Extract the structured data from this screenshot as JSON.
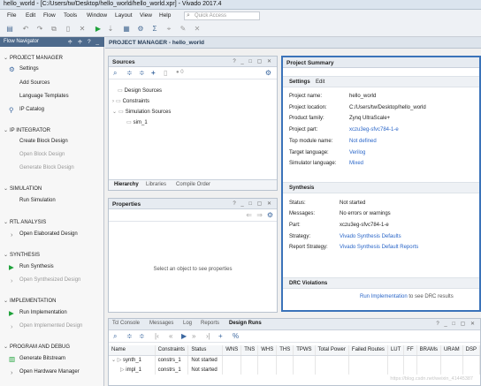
{
  "window": {
    "title": "hello_world - [C:/Users/tw/Desktop/hello_world/hello_world.xpr] - Vivado 2017.4"
  },
  "menu": [
    "File",
    "Edit",
    "Flow",
    "Tools",
    "Window",
    "Layout",
    "View",
    "Help"
  ],
  "quick_access": {
    "placeholder": "Quick Access"
  },
  "flow_navigator": {
    "title": "Flow Navigator",
    "sections": [
      {
        "label": "PROJECT MANAGER",
        "items": [
          {
            "label": "Settings",
            "enabled": true,
            "icon": "gear-icon"
          },
          {
            "label": "Add Sources",
            "enabled": true
          },
          {
            "label": "Language Templates",
            "enabled": true
          },
          {
            "label": "IP Catalog",
            "enabled": true,
            "icon": "ip-icon"
          }
        ]
      },
      {
        "label": "IP INTEGRATOR",
        "items": [
          {
            "label": "Create Block Design",
            "enabled": true
          },
          {
            "label": "Open Block Design",
            "enabled": false
          },
          {
            "label": "Generate Block Design",
            "enabled": false
          }
        ]
      },
      {
        "label": "SIMULATION",
        "items": [
          {
            "label": "Run Simulation",
            "enabled": true
          }
        ]
      },
      {
        "label": "RTL ANALYSIS",
        "items": [
          {
            "label": "Open Elaborated Design",
            "enabled": true,
            "expandable": true
          }
        ]
      },
      {
        "label": "SYNTHESIS",
        "items": [
          {
            "label": "Run Synthesis",
            "enabled": true,
            "icon": "play-icon"
          },
          {
            "label": "Open Synthesized Design",
            "enabled": false,
            "expandable": true
          }
        ]
      },
      {
        "label": "IMPLEMENTATION",
        "items": [
          {
            "label": "Run Implementation",
            "enabled": true,
            "icon": "play-icon"
          },
          {
            "label": "Open Implemented Design",
            "enabled": false,
            "expandable": true
          }
        ]
      },
      {
        "label": "PROGRAM AND DEBUG",
        "items": [
          {
            "label": "Generate Bitstream",
            "enabled": true,
            "icon": "bitstream-icon"
          },
          {
            "label": "Open Hardware Manager",
            "enabled": true,
            "expandable": true
          }
        ]
      }
    ]
  },
  "project_manager_header": "PROJECT MANAGER - hello_world",
  "sources": {
    "title": "Sources",
    "badge": "0",
    "tree": [
      "Design Sources",
      "Constraints",
      "Simulation Sources",
      "sim_1"
    ],
    "tabs": [
      "Hierarchy",
      "Libraries",
      "Compile Order"
    ]
  },
  "properties": {
    "title": "Properties",
    "empty_text": "Select an object to see properties"
  },
  "summary": {
    "title": "Project Summary",
    "settings_label": "Settings",
    "edit_label": "Edit",
    "rows": [
      {
        "label": "Project name:",
        "value": "hello_world",
        "link": false
      },
      {
        "label": "Project location:",
        "value": "C:/Users/tw/Desktop/hello_world",
        "link": false
      },
      {
        "label": "Product family:",
        "value": "Zynq UltraScale+",
        "link": false
      },
      {
        "label": "Project part:",
        "value": "xczu3eg-sfvc784-1-e",
        "link": true
      },
      {
        "label": "Top module name:",
        "value": "Not defined",
        "link": true
      },
      {
        "label": "Target language:",
        "value": "Verilog",
        "link": true
      },
      {
        "label": "Simulator language:",
        "value": "Mixed",
        "link": true
      }
    ],
    "synthesis_label": "Synthesis",
    "synthesis_rows": [
      {
        "label": "Status:",
        "value": "Not started",
        "link": false
      },
      {
        "label": "Messages:",
        "value": "No errors or warnings",
        "link": false
      },
      {
        "label": "Part:",
        "value": "xczu3eg-sfvc784-1-e",
        "link": false
      },
      {
        "label": "Strategy:",
        "value": "Vivado Synthesis Defaults",
        "link": true
      },
      {
        "label": "Report Strategy:",
        "value": "Vivado Synthesis Default Reports",
        "link": true
      }
    ],
    "drc_label": "DRC Violations",
    "drc_link": "Run Implementation",
    "drc_text": "to see DRC results"
  },
  "bottom": {
    "tabs": [
      "Tcl Console",
      "Messages",
      "Log",
      "Reports",
      "Design Runs"
    ],
    "active_tab": "Design Runs",
    "columns": [
      "Name",
      "Constraints",
      "Status",
      "WNS",
      "TNS",
      "WHS",
      "THS",
      "TPWS",
      "Total Power",
      "Failed Routes",
      "LUT",
      "FF",
      "BRAMs",
      "URAM",
      "DSP"
    ],
    "rows": [
      {
        "name": "synth_1",
        "constraints": "constrs_1",
        "status": "Not started"
      },
      {
        "name": "impl_1",
        "constraints": "constrs_1",
        "status": "Not started"
      }
    ]
  },
  "watermark": "https://blog.csdn.net/weixin_41445387"
}
